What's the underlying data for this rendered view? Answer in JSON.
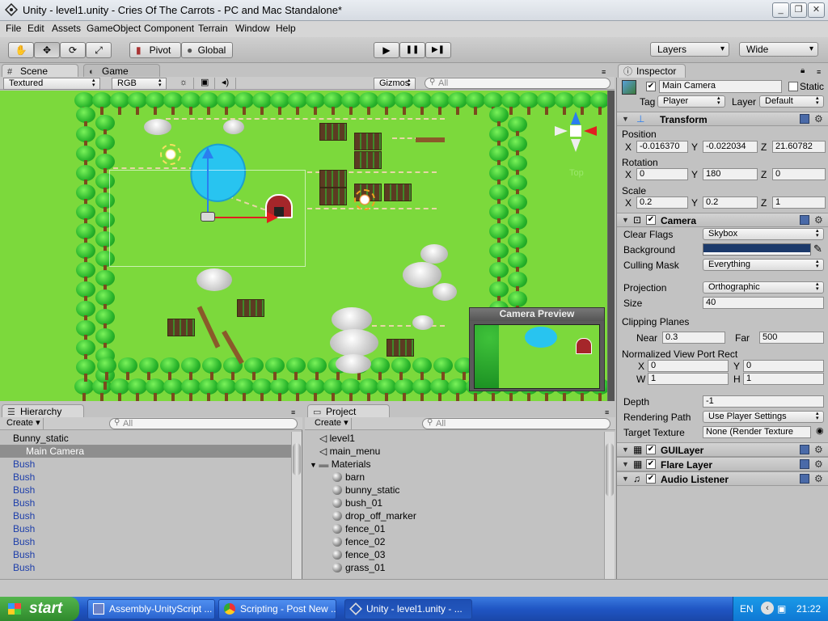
{
  "window": {
    "title": "Unity - level1.unity - Cries Of The Carrots - PC and Mac Standalone*",
    "minimize": "_",
    "maximize": "❐",
    "close": "✕"
  },
  "menu": [
    "File",
    "Edit",
    "Assets",
    "GameObject",
    "Component",
    "Terrain",
    "Window",
    "Help"
  ],
  "toolbar": {
    "pivot_label": "Pivot",
    "global_label": "Global",
    "layers_label": "Layers",
    "layout_label": "Wide",
    "tools": [
      "hand-icon",
      "move-icon",
      "rotate-icon",
      "scale-icon"
    ],
    "play": "▶",
    "pause": "❚❚",
    "step": "▶❚"
  },
  "scene_panel": {
    "tab_scene": "Scene",
    "tab_game": "Game",
    "render_mode": "Textured",
    "color_mode": "RGB",
    "gizmos": "Gizmos",
    "search_placeholder": "All",
    "gizmo_axis_label": "Top",
    "camera_preview_title": "Camera Preview"
  },
  "inspector": {
    "tab": "Inspector",
    "object_name": "Main Camera",
    "static_label": "Static",
    "tag_label": "Tag",
    "tag_value": "Player",
    "layer_label": "Layer",
    "layer_value": "Default",
    "transform": {
      "title": "Transform",
      "position_label": "Position",
      "pos_x": "-0.016370",
      "pos_y": "-0.022034",
      "pos_z": "21.60782",
      "rotation_label": "Rotation",
      "rot_x": "0",
      "rot_y": "180",
      "rot_z": "0",
      "scale_label": "Scale",
      "scale_x": "0.2",
      "scale_y": "0.2",
      "scale_z": "1"
    },
    "camera": {
      "title": "Camera",
      "clear_flags_label": "Clear Flags",
      "clear_flags": "Skybox",
      "background_label": "Background",
      "background_color": "#1c3a6b",
      "culling_mask_label": "Culling Mask",
      "culling_mask": "Everything",
      "projection_label": "Projection",
      "projection": "Orthographic",
      "size_label": "Size",
      "size": "40",
      "clipping_label": "Clipping Planes",
      "near_label": "Near",
      "near": "0.3",
      "far_label": "Far",
      "far": "500",
      "viewport_label": "Normalized View Port Rect",
      "vp_x": "0",
      "vp_y": "0",
      "vp_w": "1",
      "vp_h": "1",
      "depth_label": "Depth",
      "depth": "-1",
      "rendering_path_label": "Rendering Path",
      "rendering_path": "Use Player Settings",
      "target_texture_label": "Target Texture",
      "target_texture": "None (Render Texture"
    },
    "components": [
      "GUILayer",
      "Flare Layer",
      "Audio Listener"
    ]
  },
  "hierarchy": {
    "tab": "Hierarchy",
    "create": "Create",
    "search_placeholder": "All",
    "items": [
      "Bunny_static",
      "Main Camera",
      "Bush",
      "Bush",
      "Bush",
      "Bush",
      "Bush",
      "Bush",
      "Bush",
      "Bush",
      "Bush"
    ]
  },
  "project": {
    "tab": "Project",
    "create": "Create",
    "search_placeholder": "All",
    "scenes": [
      "level1",
      "main_menu"
    ],
    "folder": "Materials",
    "materials": [
      "barn",
      "bunny_static",
      "bush_01",
      "drop_off_marker",
      "fence_01",
      "fence_02",
      "fence_03",
      "grass_01"
    ]
  },
  "taskbar": {
    "start": "start",
    "tasks": [
      "Assembly-UnityScript ...",
      "Scripting - Post New ...",
      "Unity - level1.unity - ..."
    ],
    "lang": "EN",
    "clock": "21:22"
  },
  "colors": {
    "scene_grass": "#7cd93c",
    "water": "#28c4f0",
    "taskbar": "#2459c0",
    "start": "#3a9a36"
  }
}
